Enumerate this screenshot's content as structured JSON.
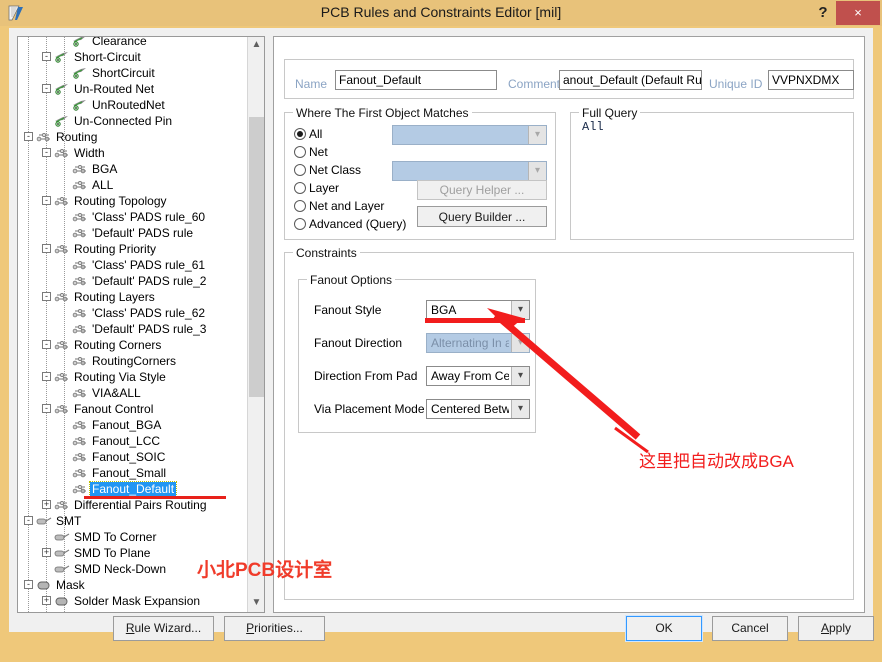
{
  "window": {
    "title": "PCB Rules and Constraints Editor [mil]",
    "help_label": "?",
    "close_label": "×",
    "app_icon": "altium-logo-icon",
    "titlebar_color": "#e8c27a",
    "close_color": "#c0504d"
  },
  "tree": {
    "selected": "Fanout_Default",
    "items": [
      {
        "label": "Clearance",
        "depth": 3,
        "box": "",
        "icon": "rule-clearance-icon"
      },
      {
        "label": "Short-Circuit",
        "depth": 2,
        "box": "-",
        "icon": "rule-clearance-icon"
      },
      {
        "label": "ShortCircuit",
        "depth": 3,
        "box": "",
        "icon": "rule-clearance-icon"
      },
      {
        "label": "Un-Routed Net",
        "depth": 2,
        "box": "-",
        "icon": "rule-clearance-icon"
      },
      {
        "label": "UnRoutedNet",
        "depth": 3,
        "box": "",
        "icon": "rule-clearance-icon"
      },
      {
        "label": "Un-Connected Pin",
        "depth": 2,
        "box": "",
        "icon": "rule-clearance-icon"
      },
      {
        "label": "Routing",
        "depth": 1,
        "box": "-",
        "icon": "rule-routing-icon"
      },
      {
        "label": "Width",
        "depth": 2,
        "box": "-",
        "icon": "rule-routing-icon"
      },
      {
        "label": "BGA",
        "depth": 3,
        "box": "",
        "icon": "rule-routing-icon"
      },
      {
        "label": "ALL",
        "depth": 3,
        "box": "",
        "icon": "rule-routing-icon"
      },
      {
        "label": "Routing Topology",
        "depth": 2,
        "box": "-",
        "icon": "rule-routing-icon"
      },
      {
        "label": "'Class' PADS rule_60",
        "depth": 3,
        "box": "",
        "icon": "rule-routing-icon"
      },
      {
        "label": "'Default' PADS rule",
        "depth": 3,
        "box": "",
        "icon": "rule-routing-icon"
      },
      {
        "label": "Routing Priority",
        "depth": 2,
        "box": "-",
        "icon": "rule-routing-icon"
      },
      {
        "label": "'Class' PADS rule_61",
        "depth": 3,
        "box": "",
        "icon": "rule-routing-icon"
      },
      {
        "label": "'Default' PADS rule_2",
        "depth": 3,
        "box": "",
        "icon": "rule-routing-icon"
      },
      {
        "label": "Routing Layers",
        "depth": 2,
        "box": "-",
        "icon": "rule-routing-icon"
      },
      {
        "label": "'Class' PADS rule_62",
        "depth": 3,
        "box": "",
        "icon": "rule-routing-icon"
      },
      {
        "label": "'Default' PADS rule_3",
        "depth": 3,
        "box": "",
        "icon": "rule-routing-icon"
      },
      {
        "label": "Routing Corners",
        "depth": 2,
        "box": "-",
        "icon": "rule-routing-icon"
      },
      {
        "label": "RoutingCorners",
        "depth": 3,
        "box": "",
        "icon": "rule-routing-icon"
      },
      {
        "label": "Routing Via Style",
        "depth": 2,
        "box": "-",
        "icon": "rule-routing-icon"
      },
      {
        "label": "VIA&ALL",
        "depth": 3,
        "box": "",
        "icon": "rule-routing-icon"
      },
      {
        "label": "Fanout Control",
        "depth": 2,
        "box": "-",
        "icon": "rule-routing-icon"
      },
      {
        "label": "Fanout_BGA",
        "depth": 3,
        "box": "",
        "icon": "rule-routing-icon"
      },
      {
        "label": "Fanout_LCC",
        "depth": 3,
        "box": "",
        "icon": "rule-routing-icon"
      },
      {
        "label": "Fanout_SOIC",
        "depth": 3,
        "box": "",
        "icon": "rule-routing-icon"
      },
      {
        "label": "Fanout_Small",
        "depth": 3,
        "box": "",
        "icon": "rule-routing-icon"
      },
      {
        "label": "Fanout_Default",
        "depth": 3,
        "box": "",
        "icon": "rule-routing-icon",
        "selected": true
      },
      {
        "label": "Differential Pairs Routing",
        "depth": 2,
        "box": "+",
        "icon": "rule-routing-icon"
      },
      {
        "label": "SMT",
        "depth": 1,
        "box": "-",
        "icon": "rule-smt-icon"
      },
      {
        "label": "SMD To Corner",
        "depth": 2,
        "box": "",
        "icon": "rule-smt-icon"
      },
      {
        "label": "SMD To Plane",
        "depth": 2,
        "box": "+",
        "icon": "rule-smt-icon"
      },
      {
        "label": "SMD Neck-Down",
        "depth": 2,
        "box": "",
        "icon": "rule-smt-icon"
      },
      {
        "label": "Mask",
        "depth": 1,
        "box": "-",
        "icon": "rule-mask-icon"
      },
      {
        "label": "Solder Mask Expansion",
        "depth": 2,
        "box": "+",
        "icon": "rule-mask-icon"
      }
    ],
    "scroll_up_icon": "chevron-up-icon",
    "scroll_down_icon": "chevron-down-icon"
  },
  "header": {
    "name_label": "Name",
    "name_value": "Fanout_Default",
    "comment_label": "Comment",
    "comment_value": "anout_Default (Default Rule)",
    "unique_id_label": "Unique ID",
    "unique_id_value": "VVPNXDMX"
  },
  "where_matches": {
    "caption": "Where The First Object Matches",
    "options": [
      {
        "label": "All",
        "selected": true
      },
      {
        "label": "Net",
        "selected": false
      },
      {
        "label": "Net Class",
        "selected": false
      },
      {
        "label": "Layer",
        "selected": false
      },
      {
        "label": "Net and Layer",
        "selected": false
      },
      {
        "label": "Advanced (Query)",
        "selected": false
      }
    ],
    "net_combo_value": "",
    "net_class_combo_value": "",
    "query_helper_label": "Query Helper ...",
    "query_builder_label": "Query Builder ..."
  },
  "full_query": {
    "caption": "Full Query",
    "text": "All"
  },
  "constraints": {
    "caption": "Constraints",
    "fanout": {
      "caption": "Fanout Options",
      "rows": [
        {
          "label": "Fanout Style",
          "value": "BGA",
          "disabled": false
        },
        {
          "label": "Fanout Direction",
          "value": "Alternating In and Out",
          "disabled": true
        },
        {
          "label": "Direction From Pad",
          "value": "Away From Center",
          "disabled": false
        },
        {
          "label": "Via Placement Mode",
          "value": "Centered Between Pads",
          "disabled": false
        }
      ]
    }
  },
  "footer": {
    "rule_wizard": "Rule Wizard...",
    "priorities": "Priorities...",
    "ok": "OK",
    "cancel": "Cancel",
    "apply": "Apply"
  },
  "annotations": {
    "arrow_note": "这里把自动改成BGA",
    "watermark": "小北PCB设计室",
    "accent_color": "#f21d1d"
  }
}
